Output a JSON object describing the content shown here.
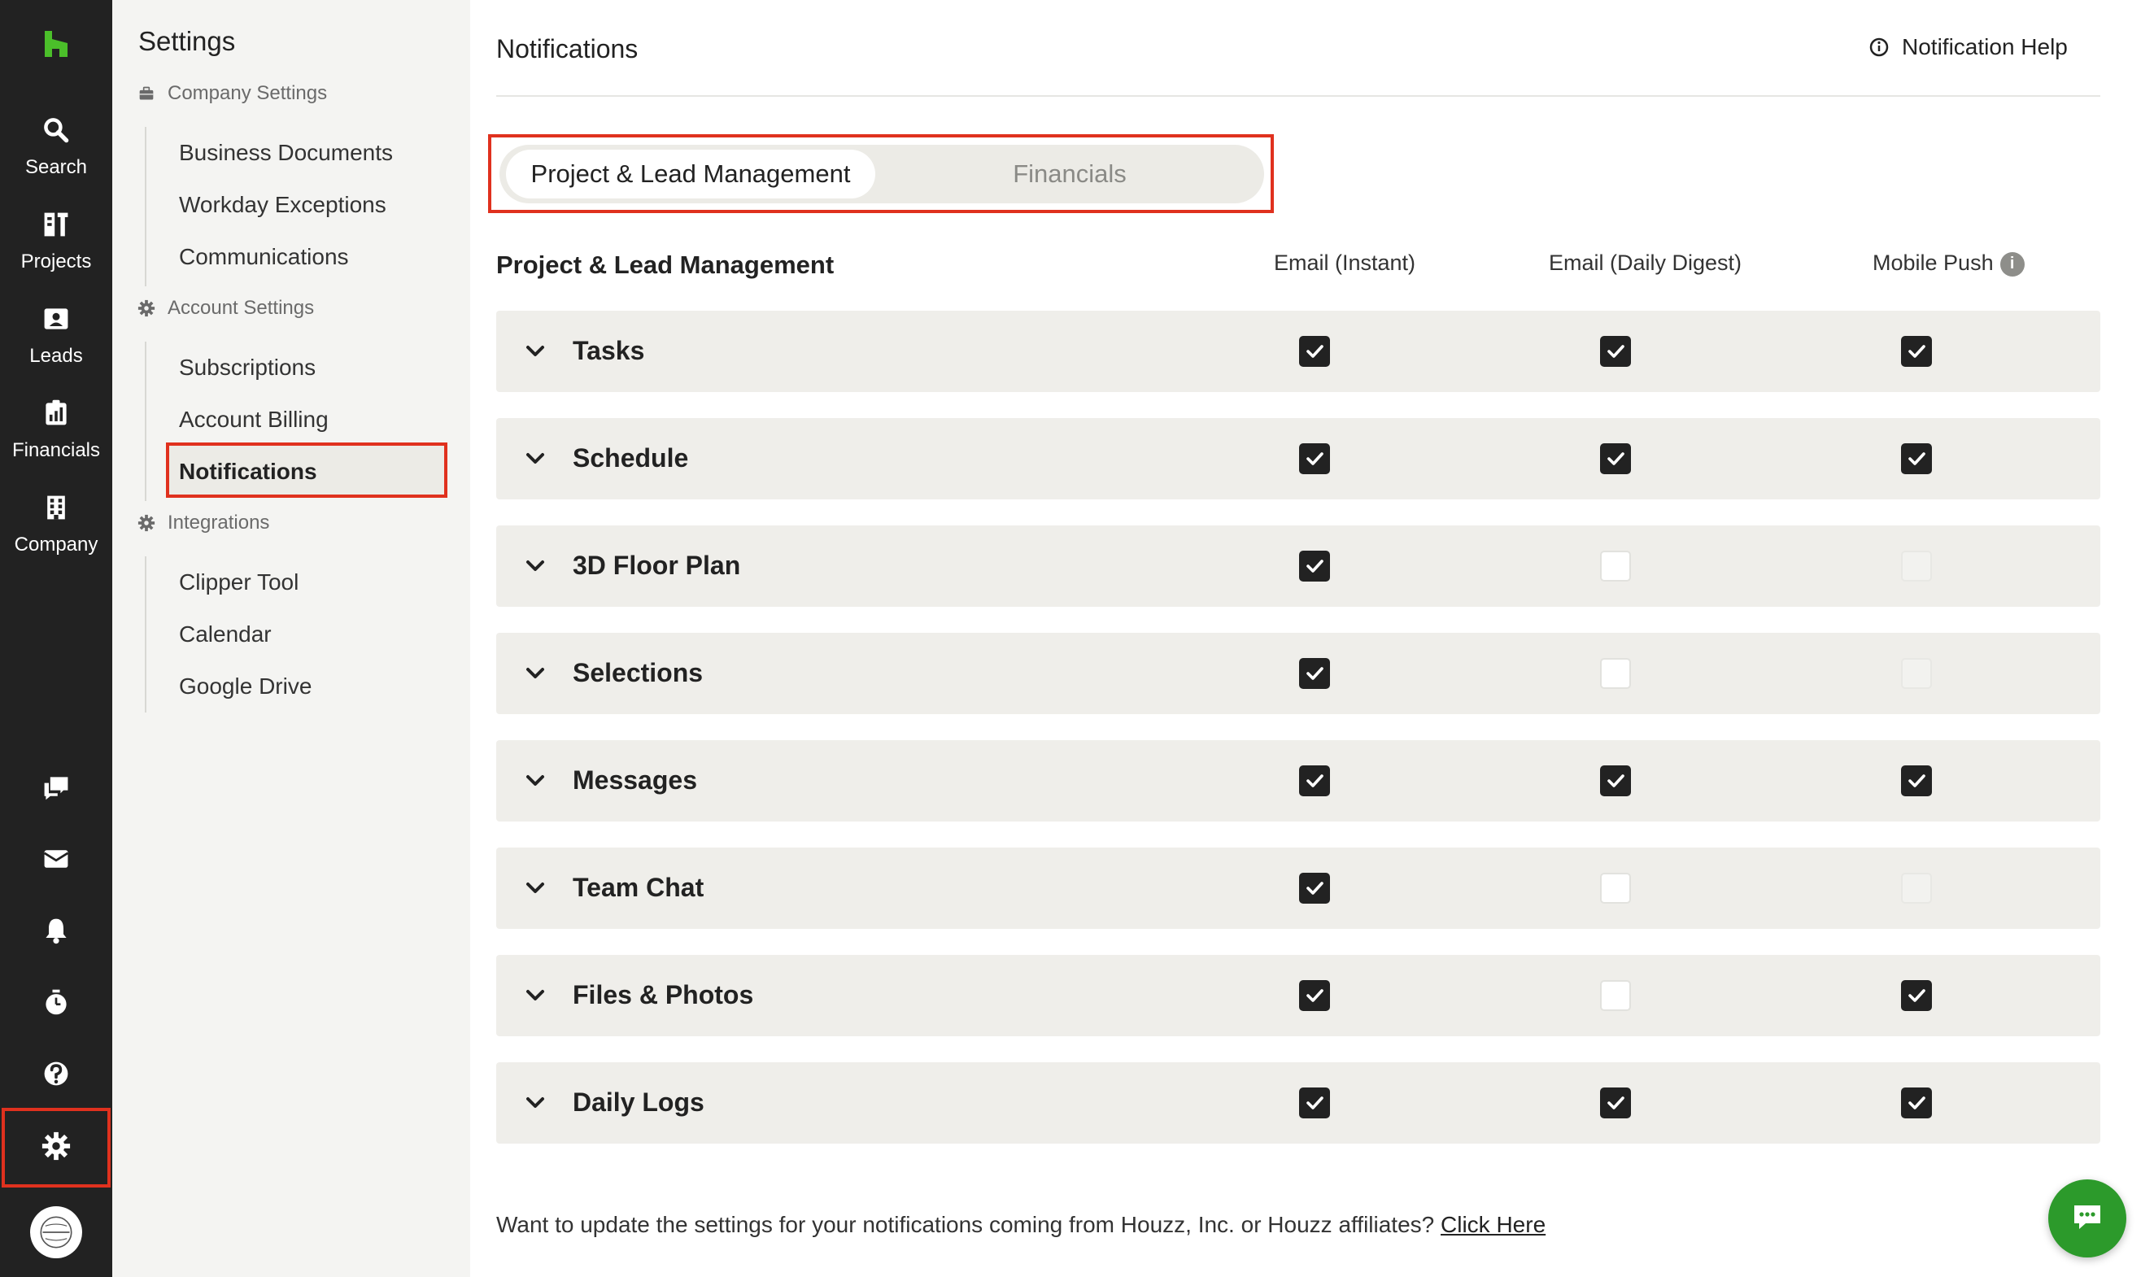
{
  "rail": {
    "items": [
      {
        "label": "Search",
        "icon": "search-icon"
      },
      {
        "label": "Projects",
        "icon": "projects-icon"
      },
      {
        "label": "Leads",
        "icon": "leads-icon"
      },
      {
        "label": "Financials",
        "icon": "financials-icon"
      },
      {
        "label": "Company",
        "icon": "company-icon"
      }
    ],
    "bottom_icons": [
      "messages-icon",
      "inbox-icon",
      "bell-icon",
      "timer-icon",
      "help-icon",
      "gear-icon",
      "avatar"
    ]
  },
  "sidebar": {
    "title": "Settings",
    "groups": [
      {
        "label": "Company Settings",
        "icon": "briefcase-icon",
        "links": [
          "Business Documents",
          "Workday Exceptions",
          "Communications"
        ]
      },
      {
        "label": "Account Settings",
        "icon": "gear-icon",
        "links": [
          "Subscriptions",
          "Account Billing",
          "Notifications"
        ]
      },
      {
        "label": "Integrations",
        "icon": "gear-icon",
        "links": [
          "Clipper Tool",
          "Calendar",
          "Google Drive"
        ]
      }
    ],
    "active": "Notifications"
  },
  "main": {
    "title": "Notifications",
    "help_label": "Notification Help",
    "tabs": [
      {
        "label": "Project & Lead Management",
        "active": true
      },
      {
        "label": "Financials",
        "active": false
      }
    ],
    "table": {
      "section_title": "Project & Lead Management",
      "columns": [
        "Email (Instant)",
        "Email (Daily Digest)",
        "Mobile Push"
      ],
      "rows": [
        {
          "name": "Tasks",
          "values": [
            "on",
            "on",
            "on"
          ]
        },
        {
          "name": "Schedule",
          "values": [
            "on",
            "on",
            "on"
          ]
        },
        {
          "name": "3D Floor Plan",
          "values": [
            "on",
            "off",
            "disabled"
          ]
        },
        {
          "name": "Selections",
          "values": [
            "on",
            "off",
            "disabled"
          ]
        },
        {
          "name": "Messages",
          "values": [
            "on",
            "on",
            "on"
          ]
        },
        {
          "name": "Team Chat",
          "values": [
            "on",
            "off",
            "disabled"
          ]
        },
        {
          "name": "Files & Photos",
          "values": [
            "on",
            "off",
            "on"
          ]
        },
        {
          "name": "Daily Logs",
          "values": [
            "on",
            "on",
            "on"
          ]
        }
      ]
    },
    "footer_text": "Want to update the settings for your notifications coming from Houzz, Inc. or Houzz affiliates?",
    "footer_link": "Click Here"
  },
  "colors": {
    "rail_bg": "#222222",
    "brand_green": "#4bbf2a",
    "highlight_red": "#e0311e",
    "chat_green": "#2c9a2b",
    "row_bg": "#efeeea"
  }
}
